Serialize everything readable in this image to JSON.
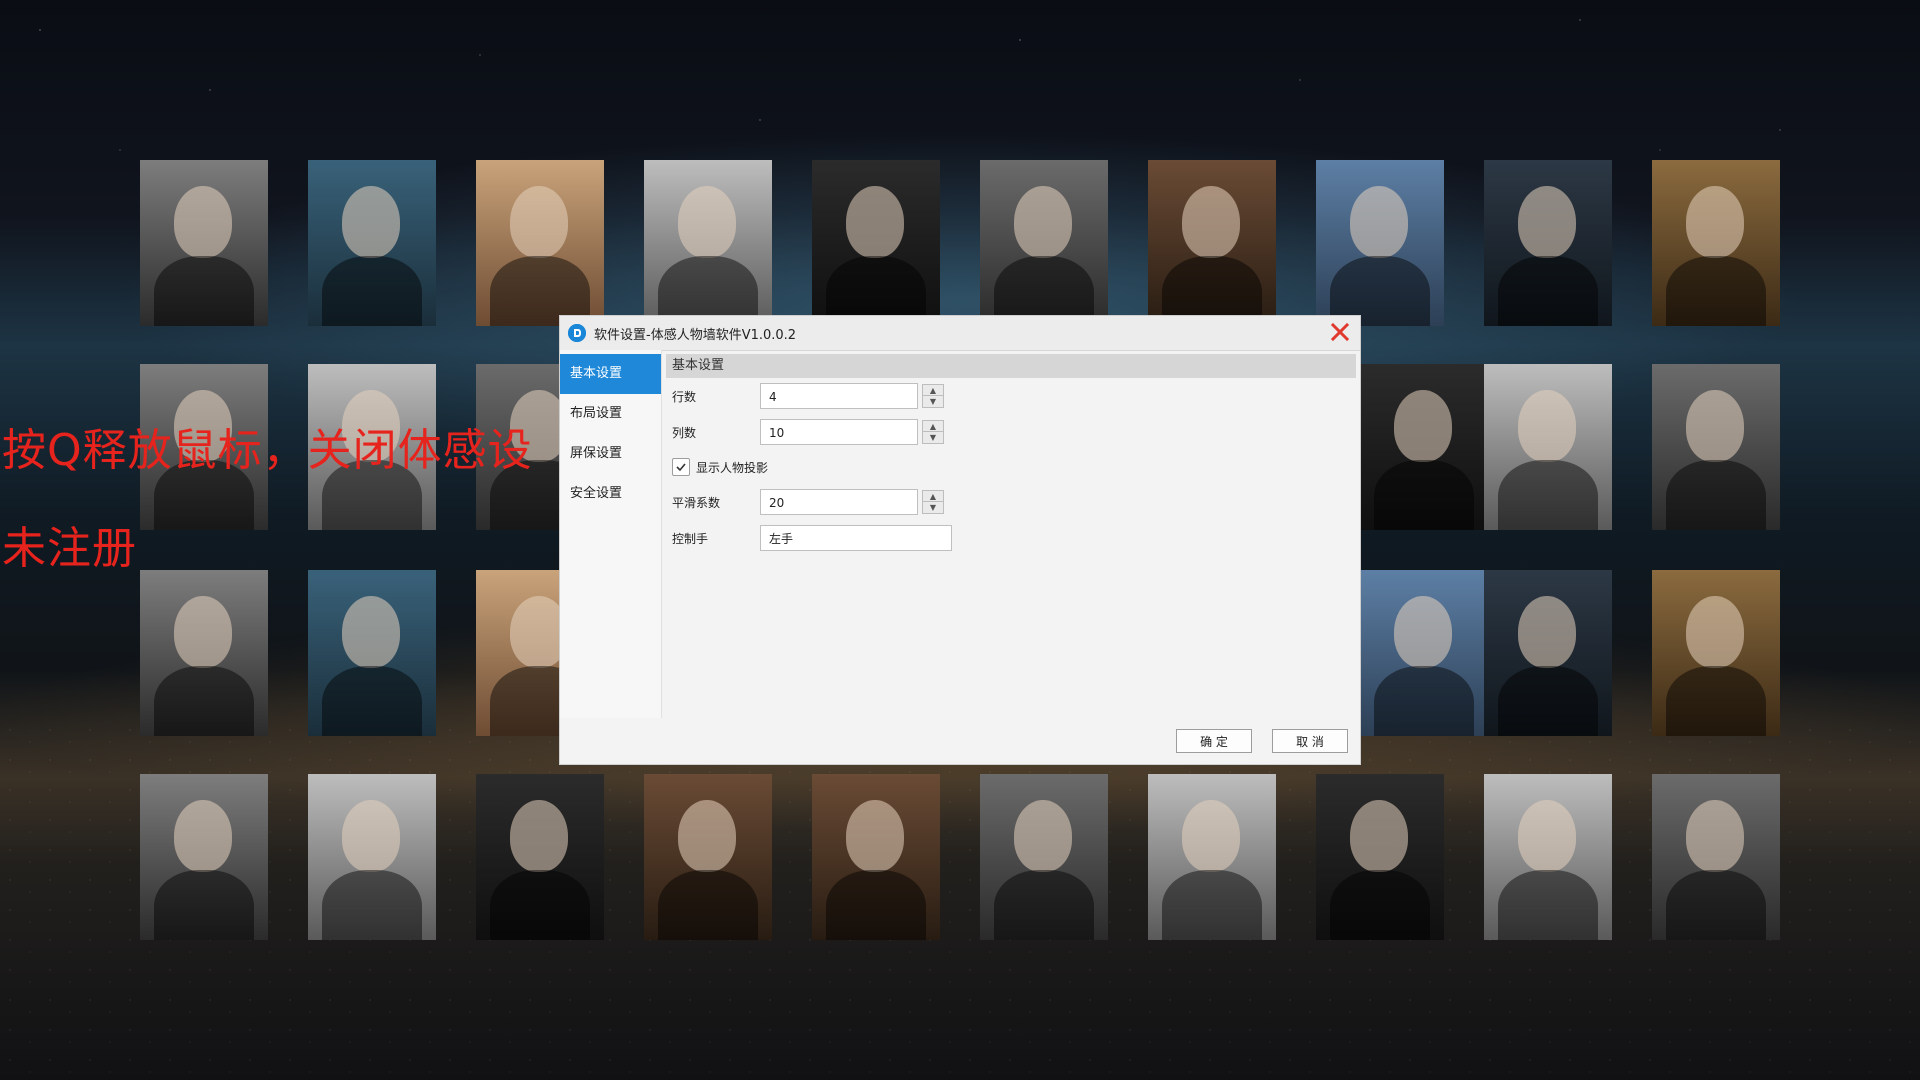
{
  "overlay": {
    "line1": "按Q释放鼠标，关闭体感设",
    "line2": "未注册"
  },
  "dialog": {
    "title": "软件设置-体感人物墙软件V1.0.0.2",
    "sidebar": [
      {
        "label": "基本设置"
      },
      {
        "label": "布局设置"
      },
      {
        "label": "屏保设置"
      },
      {
        "label": "安全设置"
      }
    ],
    "section_title": "基本设置",
    "fields": {
      "rows": {
        "label": "行数",
        "value": "4"
      },
      "cols": {
        "label": "列数",
        "value": "10"
      },
      "show_shadow": {
        "label": "显示人物投影",
        "checked": true
      },
      "smoothing": {
        "label": "平滑系数",
        "value": "20"
      },
      "control_hand": {
        "label": "控制手",
        "value": "左手"
      }
    },
    "buttons": {
      "ok": "确 定",
      "cancel": "取 消"
    }
  },
  "colors": {
    "accent": "#1f88d9",
    "overlay_red": "#e6231c",
    "close_red": "#e03a2f"
  }
}
